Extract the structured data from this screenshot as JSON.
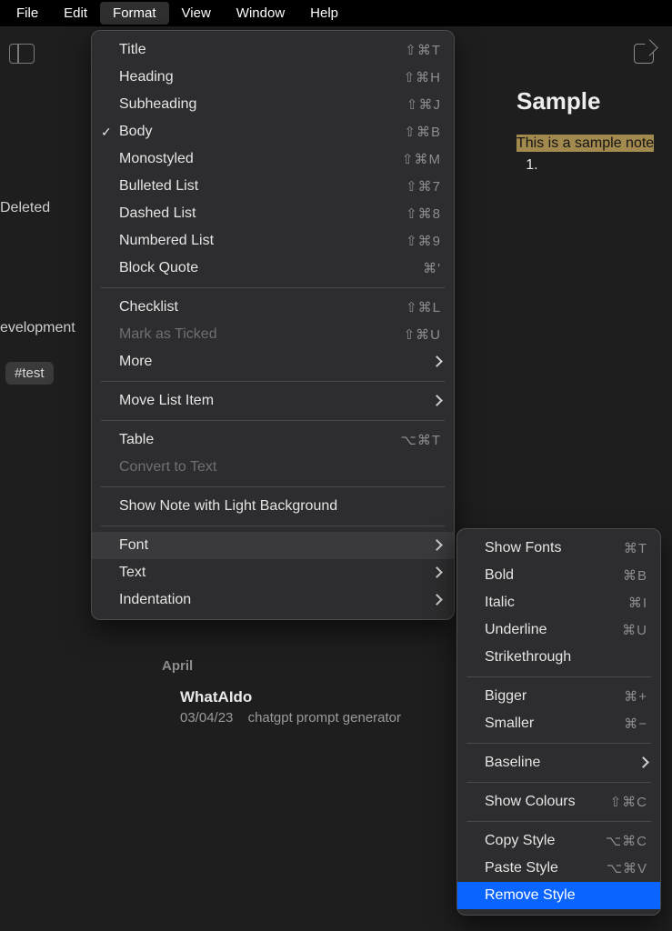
{
  "menubar": {
    "items": [
      "File",
      "Edit",
      "Format",
      "View",
      "Window",
      "Help"
    ],
    "active_index": 2
  },
  "left": {
    "deleted": "Deleted",
    "development": "evelopment",
    "tag": "#test"
  },
  "notelist": {
    "month": "April",
    "card": {
      "title": "WhatAIdo",
      "date": "03/04/23",
      "preview": "chatgpt prompt generator"
    }
  },
  "note": {
    "title": "Sample",
    "highlight_text": "This is a sample note",
    "list_first": "1."
  },
  "format_menu": {
    "sections": [
      [
        {
          "label": "Title",
          "shortcut": "⇧⌘T"
        },
        {
          "label": "Heading",
          "shortcut": "⇧⌘H"
        },
        {
          "label": "Subheading",
          "shortcut": "⇧⌘J"
        },
        {
          "label": "Body",
          "shortcut": "⇧⌘B",
          "checked": true
        },
        {
          "label": "Monostyled",
          "shortcut": "⇧⌘M"
        },
        {
          "label": "Bulleted List",
          "shortcut": "⇧⌘7"
        },
        {
          "label": "Dashed List",
          "shortcut": "⇧⌘8"
        },
        {
          "label": "Numbered List",
          "shortcut": "⇧⌘9"
        },
        {
          "label": "Block Quote",
          "shortcut": "⌘'"
        }
      ],
      [
        {
          "label": "Checklist",
          "shortcut": "⇧⌘L"
        },
        {
          "label": "Mark as Ticked",
          "shortcut": "⇧⌘U",
          "disabled": true
        },
        {
          "label": "More",
          "submenu": true
        }
      ],
      [
        {
          "label": "Move List Item",
          "submenu": true
        }
      ],
      [
        {
          "label": "Table",
          "shortcut": "⌥⌘T"
        },
        {
          "label": "Convert to Text",
          "disabled": true
        }
      ],
      [
        {
          "label": "Show Note with Light Background"
        }
      ],
      [
        {
          "label": "Font",
          "submenu": true,
          "hovered": true
        },
        {
          "label": "Text",
          "submenu": true
        },
        {
          "label": "Indentation",
          "submenu": true
        }
      ]
    ]
  },
  "font_menu": {
    "sections": [
      [
        {
          "label": "Show Fonts",
          "shortcut": "⌘T"
        },
        {
          "label": "Bold",
          "shortcut": "⌘B"
        },
        {
          "label": "Italic",
          "shortcut": "⌘I"
        },
        {
          "label": "Underline",
          "shortcut": "⌘U"
        },
        {
          "label": "Strikethrough"
        }
      ],
      [
        {
          "label": "Bigger",
          "shortcut": "⌘+"
        },
        {
          "label": "Smaller",
          "shortcut": "⌘−"
        }
      ],
      [
        {
          "label": "Baseline",
          "submenu": true
        }
      ],
      [
        {
          "label": "Show Colours",
          "shortcut": "⇧⌘C"
        }
      ],
      [
        {
          "label": "Copy Style",
          "shortcut": "⌥⌘C"
        },
        {
          "label": "Paste Style",
          "shortcut": "⌥⌘V"
        },
        {
          "label": "Remove Style",
          "selected": true
        }
      ]
    ]
  }
}
